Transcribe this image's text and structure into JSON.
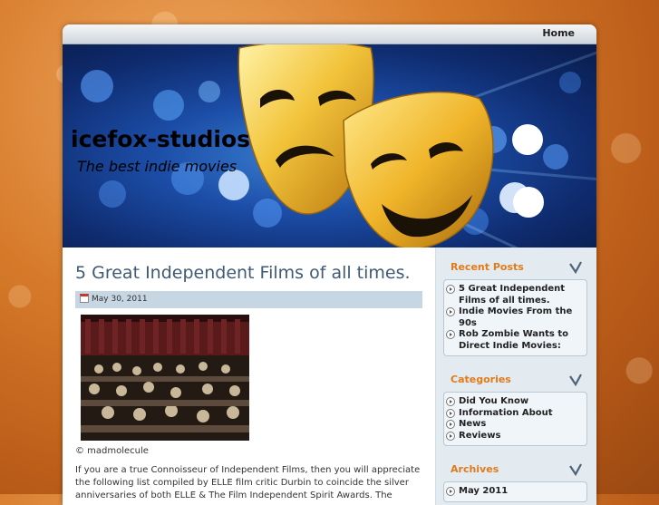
{
  "nav": {
    "home": "Home"
  },
  "header": {
    "site_title": "icefox-studios",
    "tagline": "The best indie movies",
    "image": "theater-masks-icon"
  },
  "post": {
    "title": "5 Great Independent Films of all times.",
    "date": "May 30, 2011",
    "image_credit": "© madmolecule",
    "excerpt": "If you are a true Connoisseur of Independent Films, then you will appreciate the following list compiled by ELLE film critic Durbin to coincide the silver anniversaries of both ELLE & The Film Independent Spirit Awards. The"
  },
  "sidebar": {
    "recent_posts": {
      "title": "Recent Posts",
      "items": [
        "5 Great Independent Films of all times.",
        "Indie Movies From the 90s",
        "Rob Zombie Wants to Direct Indie Movies:"
      ]
    },
    "categories": {
      "title": "Categories",
      "items": [
        "Did You Know",
        "Information About",
        "News",
        "Reviews"
      ]
    },
    "archives": {
      "title": "Archives",
      "items": [
        "May 2011"
      ]
    }
  },
  "colors": {
    "accent": "#e07b1a",
    "title": "#3f5a74",
    "sidebar_bg": "#e3ebf1"
  }
}
